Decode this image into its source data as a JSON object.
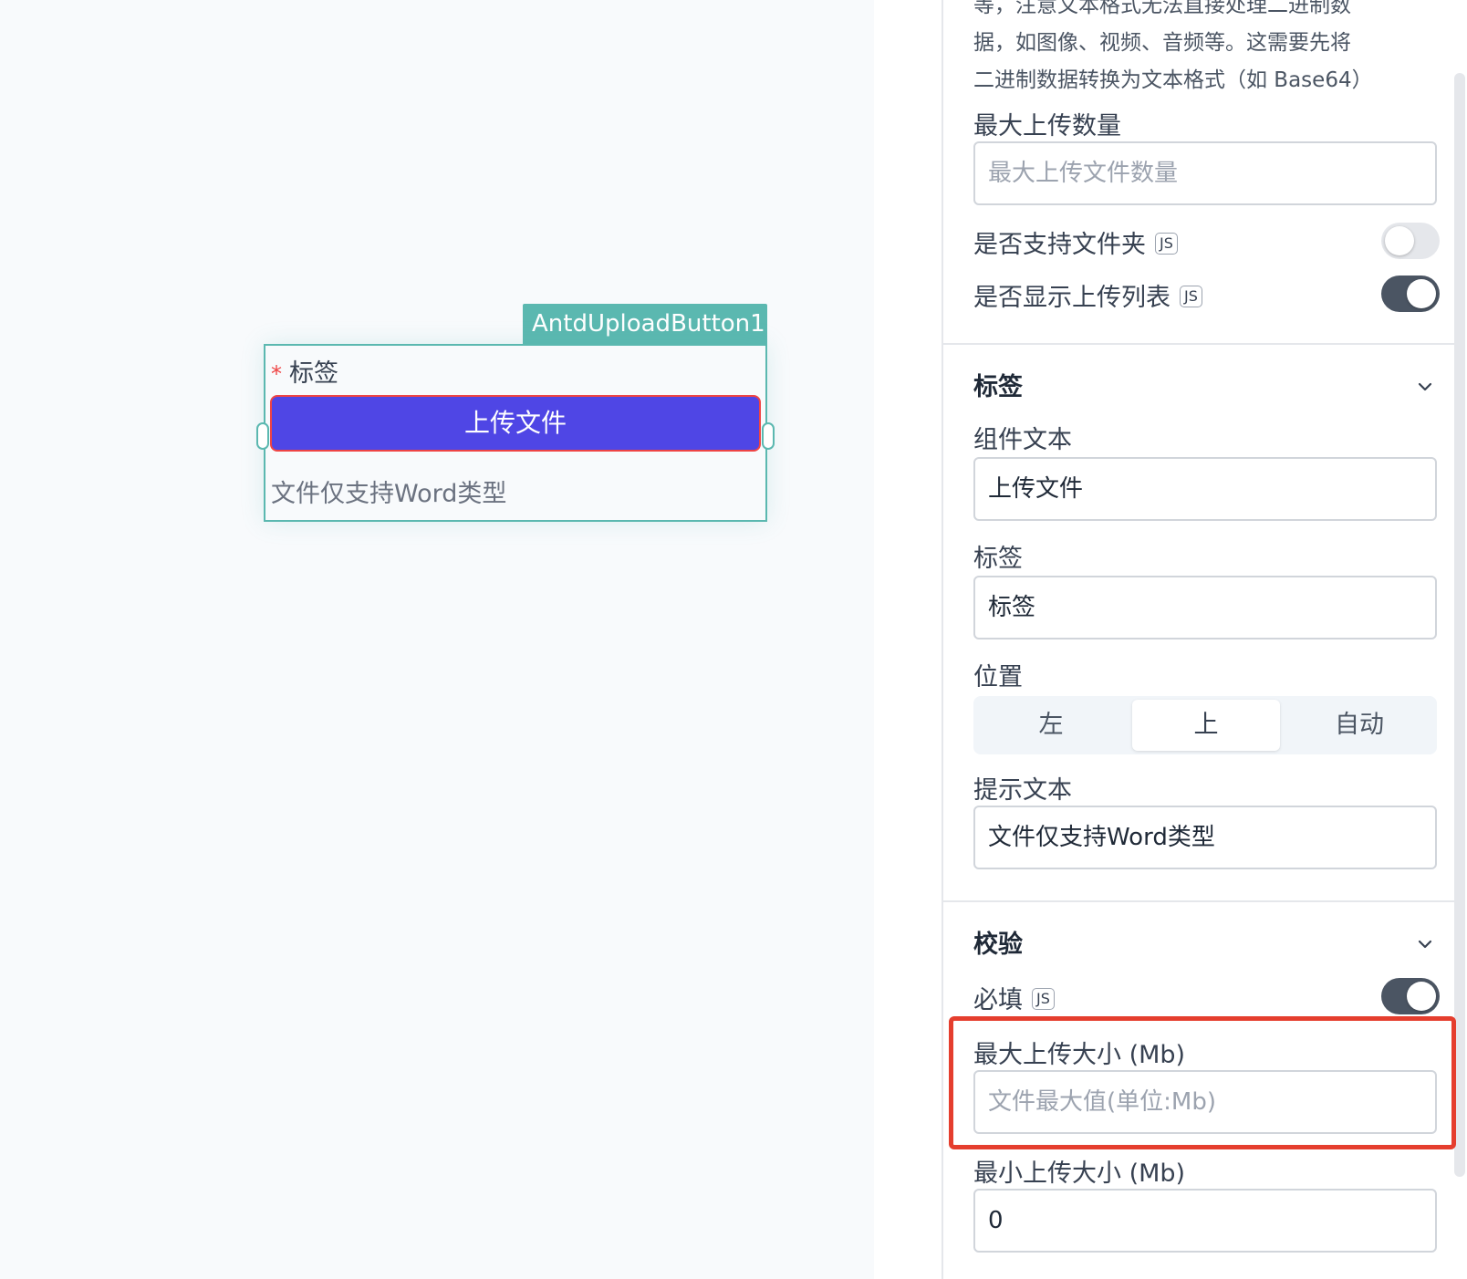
{
  "component": {
    "name_tag": "AntdUploadButton1",
    "required_mark": "*",
    "label": "标签",
    "button_text": "上传文件",
    "hint": "文件仅支持Word类型"
  },
  "panel": {
    "description_lines": [
      "等，注意文本格式无法直接处理二进制数",
      "据，如图像、视频、音频等。这需要先将",
      "二进制数据转换为文本格式（如 Base64）"
    ],
    "max_count": {
      "label": "最大上传数量",
      "placeholder": "最大上传文件数量"
    },
    "folder_support": {
      "label": "是否支持文件夹",
      "badge": "JS",
      "enabled": false
    },
    "show_list": {
      "label": "是否显示上传列表",
      "badge": "JS",
      "enabled": true
    },
    "label_section": {
      "title": "标签",
      "component_text_label": "组件文本",
      "component_text_value": "上传文件",
      "label_label": "标签",
      "label_value": "标签",
      "position_label": "位置",
      "position_options": [
        "左",
        "上",
        "自动"
      ],
      "position_selected": "上",
      "hint_label": "提示文本",
      "hint_value": "文件仅支持Word类型"
    },
    "validation_section": {
      "title": "校验",
      "required_label": "必填",
      "required_badge": "JS",
      "required_enabled": true,
      "max_size_label": "最大上传大小 (Mb)",
      "max_size_placeholder": "文件最大值(单位:Mb)",
      "min_size_label": "最小上传大小 (Mb)",
      "min_size_value": "0"
    }
  },
  "colors": {
    "teal_accent": "#5bb8b0",
    "button_primary": "#4f46e5",
    "highlight_red": "#e53e2e",
    "required_red": "#ef4444"
  }
}
